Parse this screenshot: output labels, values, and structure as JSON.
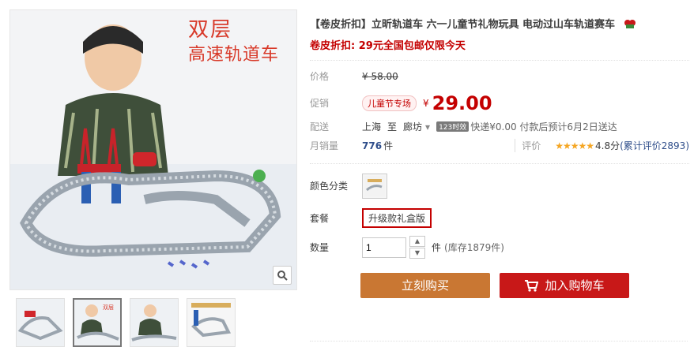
{
  "gallery": {
    "overlay_title": "双层",
    "overlay_sub": "高速轨道车",
    "thumbnails": [
      "thumb-1",
      "thumb-2",
      "thumb-3",
      "thumb-4"
    ]
  },
  "product": {
    "title": "【卷皮折扣】立昕轨道车 六一儿童节礼物玩具 电动过山车轨道赛车",
    "promo": "卷皮折扣: 29元全国包邮仅限今天"
  },
  "price": {
    "label": "价格",
    "original": "¥ 58.00",
    "promo_label": "促销",
    "tag": "儿童节专场",
    "yen": "¥",
    "current": "29.00"
  },
  "shipping": {
    "label": "配送",
    "from": "上海",
    "to_word": "至",
    "dest": "廊坊",
    "badge": "123时效",
    "fee_text": "快递¥0.00 付款后预计6月2日送达"
  },
  "sales": {
    "label": "月销量",
    "count": "776",
    "unit": "件",
    "rating_label": "评价",
    "stars": "★★★★★",
    "score": "4.8分",
    "review_text": "(累计评价2893)"
  },
  "sku": {
    "color_label": "颜色分类",
    "combo_label": "套餐",
    "combo_value": "升级款礼盒版",
    "qty_label": "数量",
    "qty_value": "1",
    "qty_unit": "件",
    "stock": "(库存1879件)"
  },
  "actions": {
    "buy_label": "立刻购买",
    "cart_label": "加入购物车"
  },
  "colors": {
    "accent_red": "#c40000",
    "buy_btn": "#c97733",
    "cart_btn": "#c81818"
  }
}
